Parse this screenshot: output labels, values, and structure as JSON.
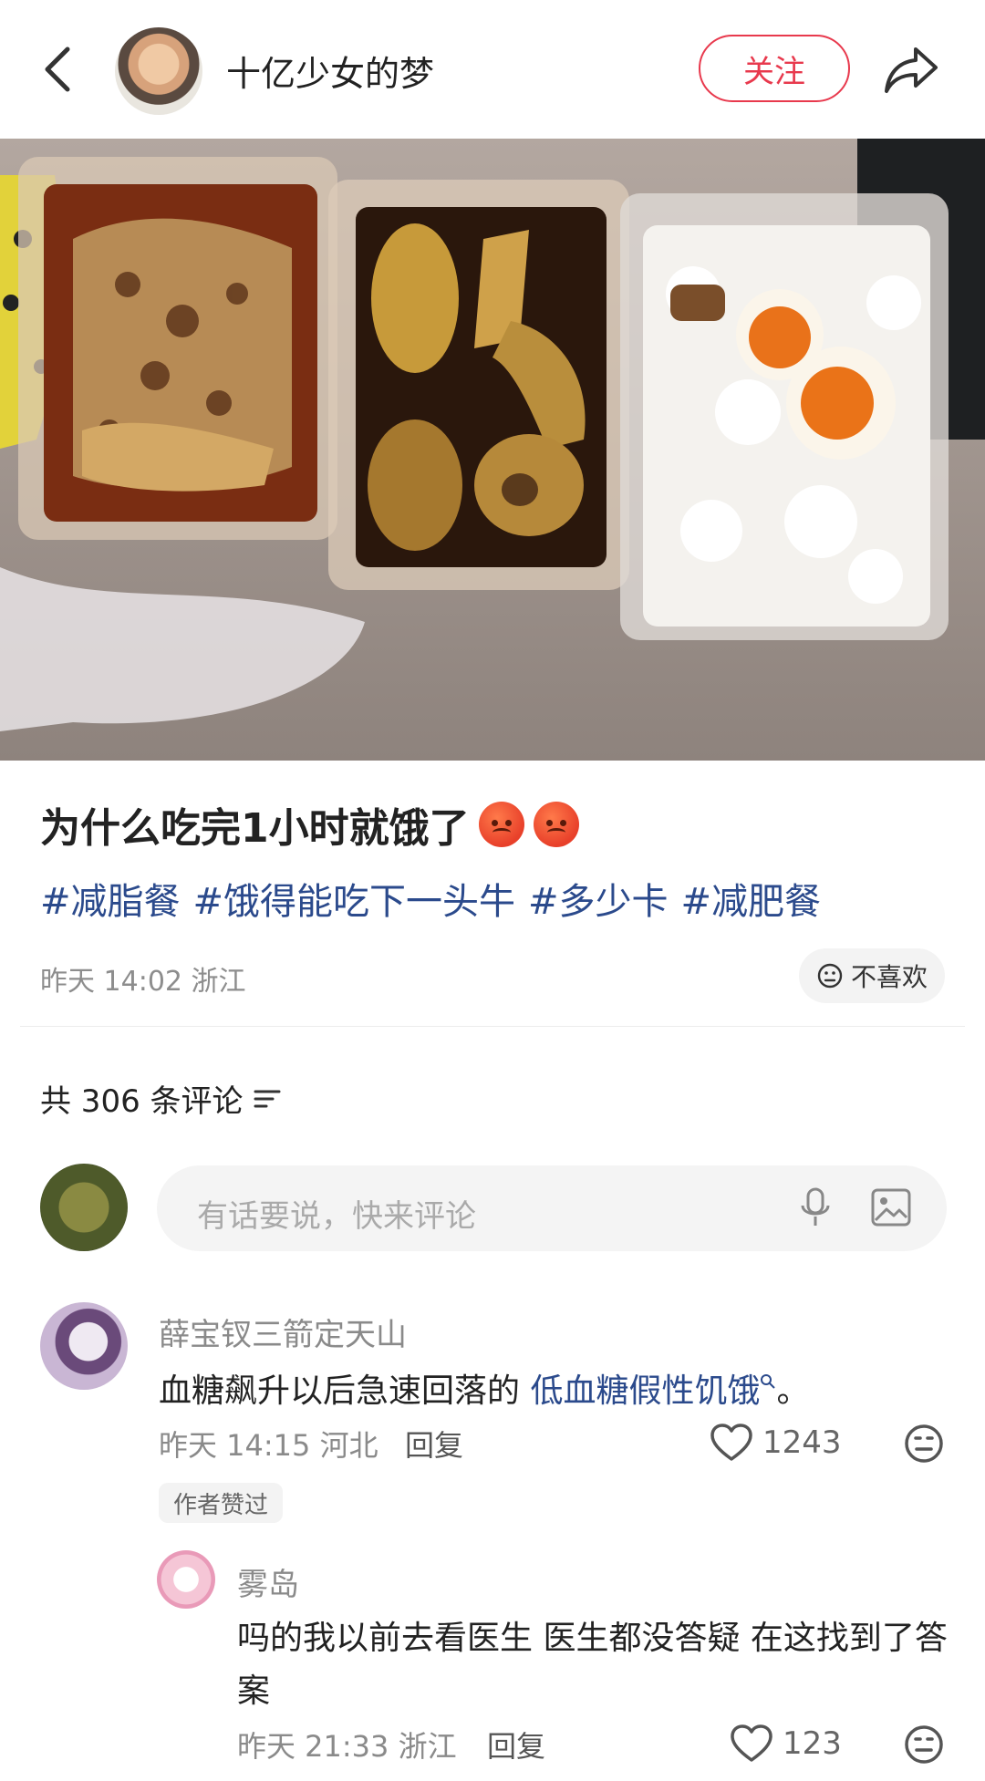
{
  "header": {
    "author": "十亿少女的梦",
    "follow_label": "关注"
  },
  "post": {
    "title": "为什么吃完1小时就饿了",
    "tags": [
      "#减脂餐",
      "#饿得能吃下一头牛",
      "#多少卡",
      "#减肥餐"
    ],
    "meta": "昨天 14:02 浙江",
    "dislike_label": "不喜欢"
  },
  "comments_header": {
    "count_text": "共 306 条评论"
  },
  "comment_input": {
    "placeholder": "有话要说，快来评论"
  },
  "comments": [
    {
      "name": "薛宝钗三箭定天山",
      "text_before": "血糖飙升以后急速回落的 ",
      "link_text": "低血糖假性饥饿",
      "text_after": "。",
      "meta": "昨天 14:15 河北",
      "reply_label": "回复",
      "likes": "1243",
      "badge": "作者赞过"
    },
    {
      "name": "雾岛",
      "text": "吗的我以前去看医生 医生都没答疑 在这找到了答案",
      "meta": "昨天 21:33 浙江",
      "reply_label": "回复",
      "likes": "123"
    }
  ],
  "colors": {
    "accent": "#e8394d",
    "tag_link": "#2b4a8c",
    "meta_gray": "#8d8d8d"
  }
}
